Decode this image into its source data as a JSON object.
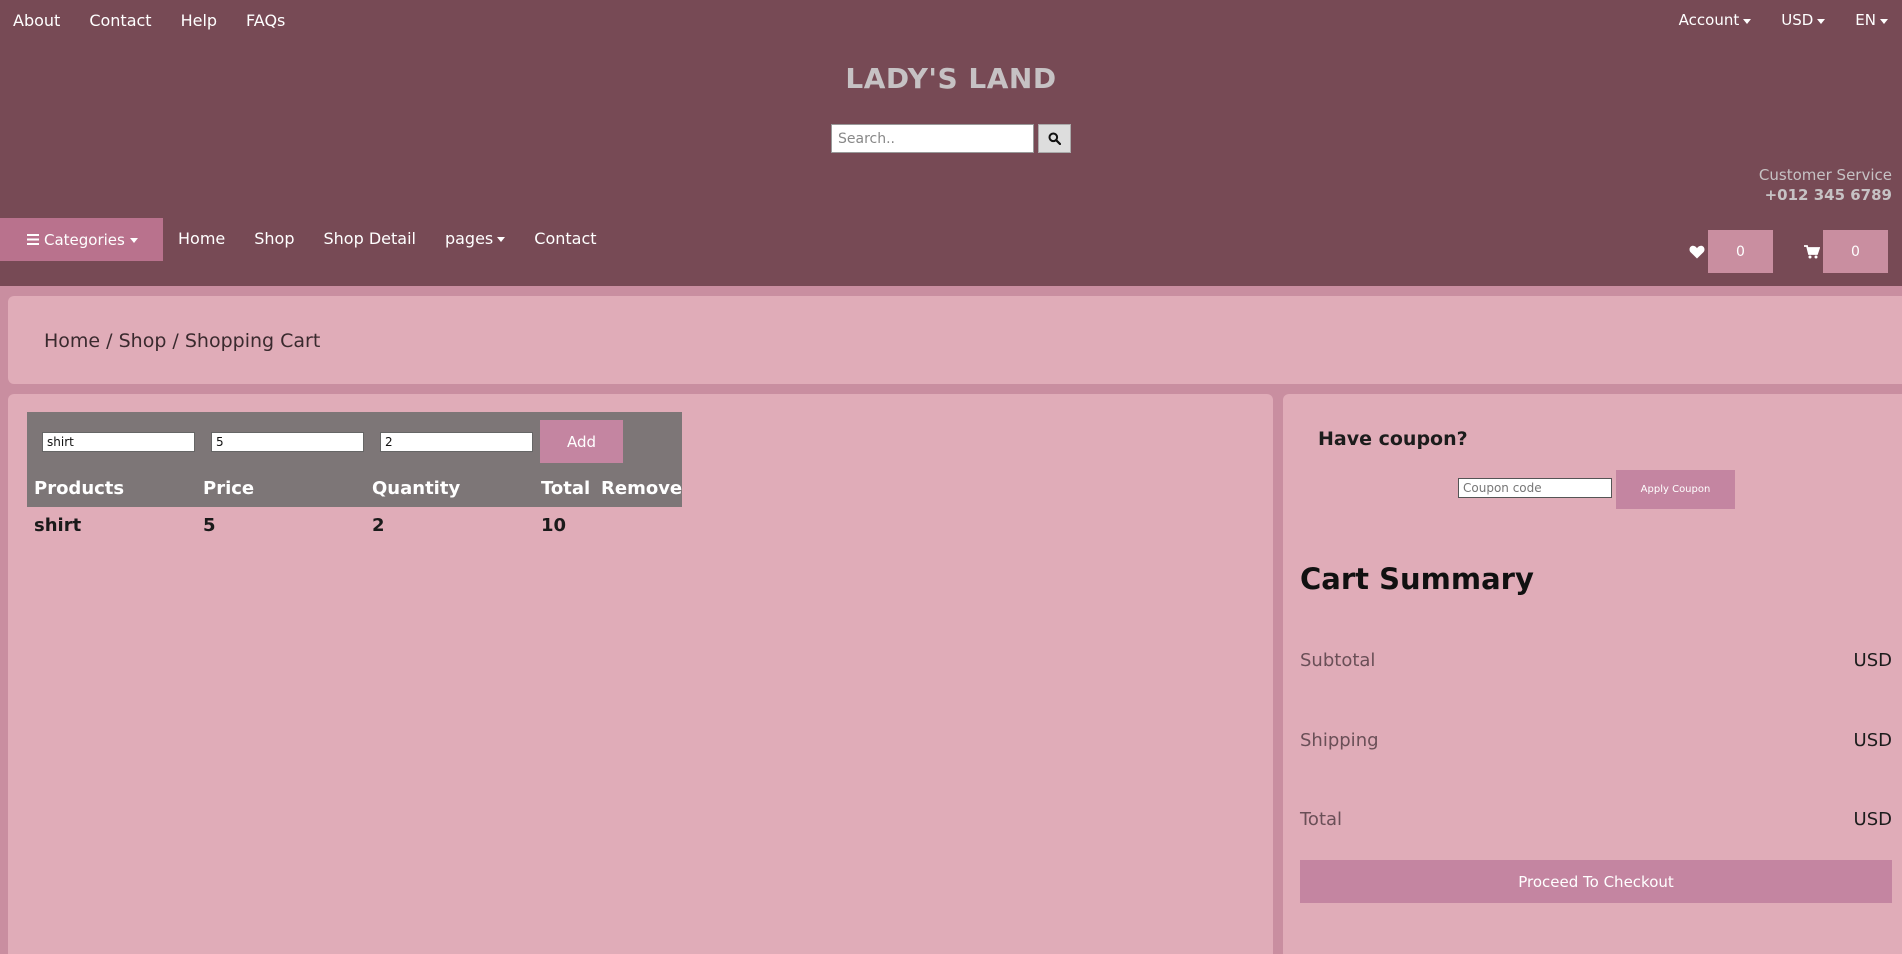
{
  "topbar": {
    "links": [
      "About",
      "Contact",
      "Help",
      "FAQs"
    ],
    "account": "Account",
    "currency": "USD",
    "language": "EN"
  },
  "brand": {
    "logo": "LADY'S LAND"
  },
  "search": {
    "placeholder": "Search..",
    "icon": "search-icon"
  },
  "customer_service": {
    "label": "Customer Service",
    "phone": "+012 345 6789"
  },
  "nav": {
    "categories_label": "Categories",
    "items": [
      "Home",
      "Shop",
      "Shop Detail",
      "pages",
      "Contact"
    ]
  },
  "counters": {
    "wishlist": "0",
    "cart": "0",
    "wishlist_icon": "heart-icon",
    "cart_icon": "cart-icon"
  },
  "breadcrumb": "Home / Shop / Shopping Cart",
  "cart": {
    "inputs": {
      "product": "shirt",
      "price": "5",
      "quantity": "2"
    },
    "add_label": "Add",
    "headers": [
      "Products",
      "Price",
      "Quantity",
      "Total",
      "Remove"
    ],
    "rows": [
      {
        "product": "shirt",
        "price": "5",
        "quantity": "2",
        "total": "10"
      }
    ]
  },
  "coupon": {
    "title": "Have coupon?",
    "placeholder": "Coupon code",
    "apply_label": "Apply Coupon"
  },
  "summary": {
    "title": "Cart Summary",
    "subtotal_label": "Subtotal",
    "subtotal_value": "USD",
    "shipping_label": "Shipping",
    "shipping_value": "USD",
    "total_label": "Total",
    "total_value": "USD",
    "checkout_label": "Proceed To Checkout"
  },
  "colors": {
    "header_bg": "#774a55",
    "panel_bg": "#e0acb8",
    "accent": "#c485a1",
    "table_head_bg": "#7d7677"
  }
}
